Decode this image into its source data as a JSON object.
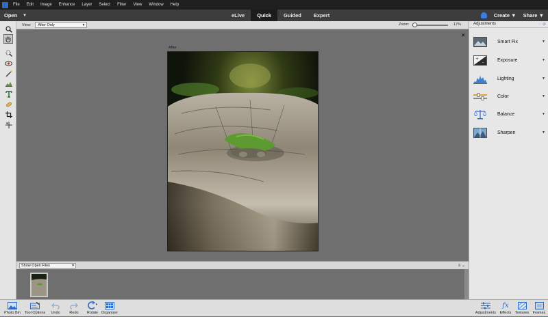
{
  "menubar": {
    "items": [
      "File",
      "Edit",
      "Image",
      "Enhance",
      "Layer",
      "Select",
      "Filter",
      "View",
      "Window",
      "Help"
    ]
  },
  "modebar": {
    "open_label": "Open",
    "tabs": [
      {
        "label": "eLive",
        "active": false
      },
      {
        "label": "Quick",
        "active": true
      },
      {
        "label": "Guided",
        "active": false
      },
      {
        "label": "Expert",
        "active": false
      }
    ],
    "create_label": "Create",
    "share_label": "Share"
  },
  "options": {
    "view_label": "View:",
    "view_value": "After Only",
    "zoom_label": "Zoom:",
    "zoom_value": "17%",
    "zoom_fraction": 0.17
  },
  "canvas": {
    "after_label": "After",
    "close_glyph": "×"
  },
  "bin": {
    "select_value": "Show Open Files"
  },
  "taskbar": {
    "left": [
      {
        "label": "Photo Bin",
        "icon": "photo-bin-icon"
      },
      {
        "label": "Tool Options",
        "icon": "tool-options-icon"
      },
      {
        "label": "Undo",
        "icon": "undo-icon"
      },
      {
        "label": "Redo",
        "icon": "redo-icon"
      },
      {
        "label": "Rotate",
        "icon": "rotate-icon"
      },
      {
        "label": "Organizer",
        "icon": "organizer-icon"
      }
    ],
    "right": [
      {
        "label": "Adjustments",
        "icon": "adjustments-icon"
      },
      {
        "label": "Effects",
        "icon": "effects-icon"
      },
      {
        "label": "Textures",
        "icon": "textures-icon"
      },
      {
        "label": "Frames",
        "icon": "frames-icon"
      }
    ]
  },
  "panel": {
    "title": "Adjustments",
    "items": [
      {
        "label": "Smart Fix",
        "icon": "smart-fix-icon"
      },
      {
        "label": "Exposure",
        "icon": "exposure-icon"
      },
      {
        "label": "Lighting",
        "icon": "lighting-icon"
      },
      {
        "label": "Color",
        "icon": "color-icon"
      },
      {
        "label": "Balance",
        "icon": "balance-icon"
      },
      {
        "label": "Sharpen",
        "icon": "sharpen-icon"
      }
    ]
  },
  "colors": {
    "menubar_bg": "#1f1f1f",
    "modebar_bg": "#3d3d3d",
    "active_tab_bg": "#1c1c1c",
    "workspace_bg": "#6f6f6f",
    "panel_bg": "#e7e7e7",
    "accent_blue": "#3b7de0"
  }
}
